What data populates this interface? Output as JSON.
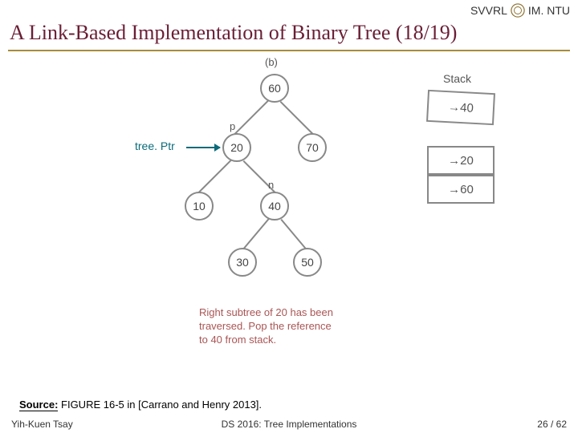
{
  "header": {
    "org_left": "SVVRL",
    "org_right": "IM. NTU"
  },
  "title": "A Link-Based Implementation of Binary Tree (18/19)",
  "figure": {
    "panel_label": "(b)",
    "treeptr_label": "tree. Ptr",
    "nodes": {
      "root": "60",
      "left": "20",
      "right": "70",
      "ll": "10",
      "lr": "40",
      "lrl": "30",
      "lrr": "50"
    },
    "labels": {
      "p": "p",
      "n": "n"
    },
    "stack": {
      "title": "Stack",
      "items": [
        "→40",
        "→20",
        "→60"
      ]
    },
    "caption_line1": "Right subtree of 20 has been",
    "caption_line2": "traversed. Pop the reference",
    "caption_line3": "to 40 from stack."
  },
  "source": {
    "label": "Source:",
    "text": " FIGURE 16-5 in [Carrano and Henry 2013]."
  },
  "footer": {
    "author": "Yih-Kuen Tsay",
    "course": "DS 2016: Tree Implementations",
    "page": "26 / 62"
  }
}
